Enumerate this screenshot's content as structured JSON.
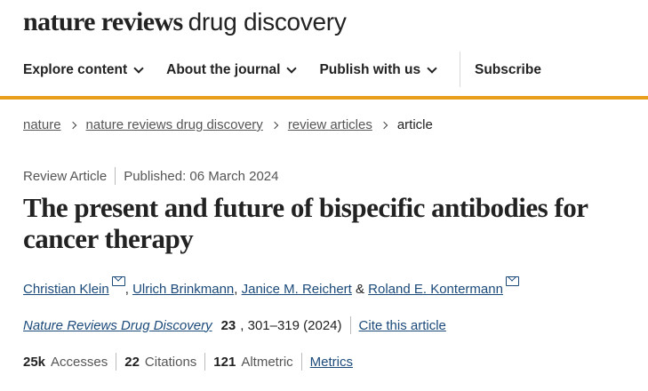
{
  "logo": {
    "bold": "nature reviews",
    "light": "drug discovery"
  },
  "nav": {
    "items": [
      "Explore content",
      "About the journal",
      "Publish with us"
    ],
    "subscribe": "Subscribe"
  },
  "breadcrumb": [
    "nature",
    "nature reviews drug discovery",
    "review articles",
    "article"
  ],
  "meta": {
    "type": "Review Article",
    "published": "Published: 06 March 2024"
  },
  "title": "The present and future of bispecific antibodies for cancer therapy",
  "authors": {
    "a1": "Christian Klein",
    "a2": "Ulrich Brinkmann",
    "a3": "Janice M. Reichert",
    "a4": "Roland E. Kontermann",
    "sep": ", ",
    "amp": " & "
  },
  "journal": {
    "name": "Nature Reviews Drug Discovery",
    "volume": "23",
    "pages": ", 301–319 (2024)",
    "cite": "Cite this article"
  },
  "metrics": {
    "accesses_value": "25k",
    "accesses_label": "Accesses",
    "citations_value": "22",
    "citations_label": "Citations",
    "altmetric_value": "121",
    "altmetric_label": "Altmetric",
    "link": "Metrics"
  },
  "colors": {
    "accent": "#e8a01c",
    "link": "#1b4a7a",
    "text": "#222222",
    "muted": "#555555"
  },
  "icons": {
    "dropdown": "chevron-down-icon",
    "breadcrumb": "chevron-right-icon",
    "email": "mail-icon"
  }
}
